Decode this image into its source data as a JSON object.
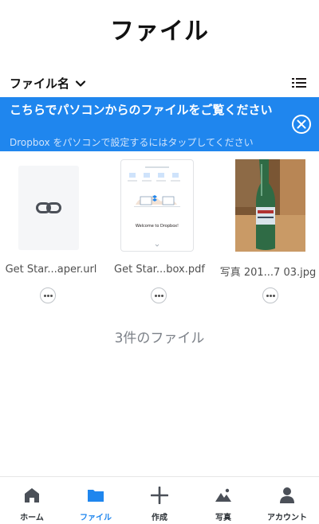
{
  "header": {
    "title": "ファイル"
  },
  "sort": {
    "label": "ファイル名"
  },
  "banner": {
    "title": "こちらでパソコンからのファイルをご覧ください",
    "subtitle": "Dropbox をパソコンで設定するにはタップしてください",
    "color": "#1f86ee"
  },
  "files": [
    {
      "name": "Get Star...aper.url",
      "icon": "link-icon"
    },
    {
      "name": "Get Star...box.pdf",
      "icon": "pdf-thumbnail",
      "preview_text": "Welcome to Dropbox!"
    },
    {
      "name": "写真 201...7 03.jpg",
      "icon": "photo-thumbnail"
    }
  ],
  "count_text": "3件のファイル",
  "tabs": [
    {
      "label": "ホーム",
      "icon": "home-icon",
      "active": false
    },
    {
      "label": "ファイル",
      "icon": "folder-icon",
      "active": true
    },
    {
      "label": "作成",
      "icon": "plus-icon",
      "active": false
    },
    {
      "label": "写真",
      "icon": "photos-icon",
      "active": false
    },
    {
      "label": "アカウント",
      "icon": "person-icon",
      "active": false
    }
  ],
  "accent_color": "#1f86ee"
}
